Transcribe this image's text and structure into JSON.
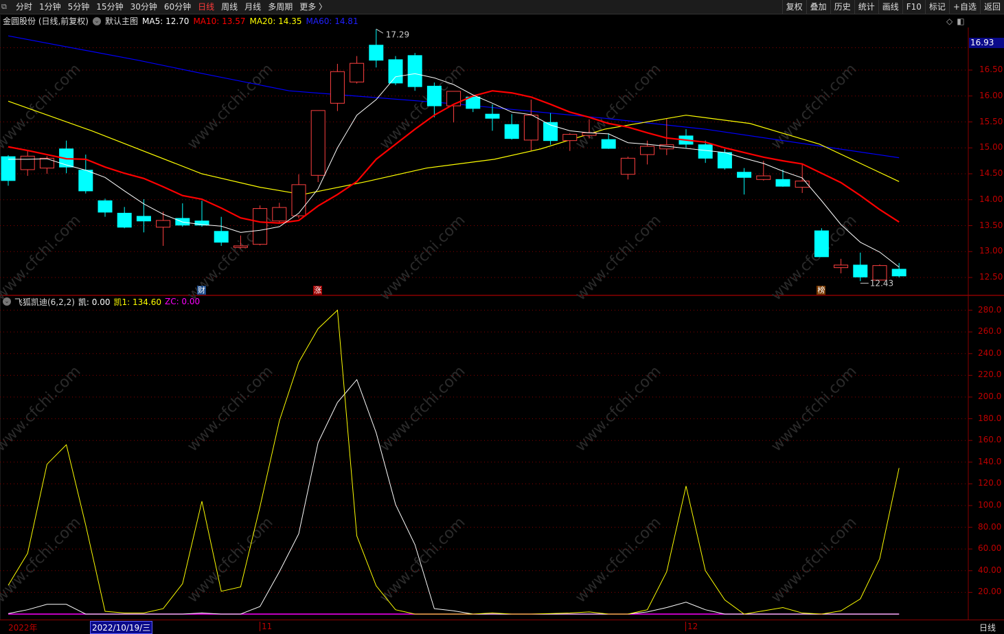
{
  "toolbar": {
    "tabs": [
      "分时",
      "1分钟",
      "5分钟",
      "15分钟",
      "30分钟",
      "60分钟",
      "日线",
      "周线",
      "月线",
      "多周期",
      "更多 〉"
    ],
    "active_tab": "日线",
    "right_buttons": [
      "复权",
      "叠加",
      "历史",
      "统计",
      "画线",
      "F10",
      "标记",
      "+自选",
      "返回"
    ]
  },
  "info": {
    "stock": "金圆股份 (日线,前复权)",
    "template": "默认主图",
    "ma5": "MA5: 12.70",
    "ma10": "MA10: 13.57",
    "ma20": "MA20: 14.35",
    "ma60": "MA60: 14.81"
  },
  "indicator_info": {
    "name": "飞狐凯迪(6,2,2)",
    "kai": "凯: 0.00",
    "kai1": "凯1: 134.60",
    "zc": "ZC: 0.00"
  },
  "colors": {
    "up": "#ff4040",
    "down": "#00ffff",
    "ma5": "#ffffff",
    "ma10": "#ff0000",
    "ma20": "#ffff00",
    "ma60": "#0000ff",
    "kai": "#ffffff",
    "kai1": "#ffff00",
    "zc": "#ff00ff",
    "grid": "#8b0000"
  },
  "price_axis": {
    "current": "16.93",
    "ticks": [
      "16.50",
      "16.00",
      "15.50",
      "15.00",
      "14.50",
      "14.00",
      "13.50",
      "13.00",
      "12.50"
    ]
  },
  "indicator_axis": {
    "ticks": [
      "280.0",
      "260.0",
      "240.0",
      "220.0",
      "200.0",
      "180.0",
      "160.0",
      "140.0",
      "120.0",
      "100.0",
      "80.00",
      "60.00",
      "40.00",
      "20.00"
    ]
  },
  "annotations": {
    "high": "17.29",
    "low": "12.43"
  },
  "markers": [
    {
      "text": "财",
      "candle": 10,
      "bg": "#1a4a8a"
    },
    {
      "text": "涨",
      "candle": 16,
      "bg": "#a00000"
    },
    {
      "text": "榜",
      "candle": 42,
      "bg": "#7a3a00"
    }
  ],
  "time_axis": {
    "year": "2022年",
    "selected_date": "2022/10/19/三",
    "month11": "11",
    "month12": "12",
    "period": "日线"
  },
  "watermark": "www.cfchi.com",
  "chart_data": [
    {
      "type": "candlestick",
      "title": "金圆股份 日线",
      "ylim": [
        12.3,
        17.35
      ],
      "ohlc": [
        [
          14.83,
          14.86,
          14.27,
          14.37
        ],
        [
          14.58,
          14.96,
          14.46,
          14.84
        ],
        [
          14.61,
          14.84,
          14.5,
          14.8
        ],
        [
          14.98,
          15.14,
          14.51,
          14.63
        ],
        [
          14.57,
          14.87,
          14.12,
          14.17
        ],
        [
          13.98,
          14.02,
          13.67,
          13.76
        ],
        [
          13.74,
          13.86,
          13.45,
          13.47
        ],
        [
          13.68,
          14.01,
          13.37,
          13.59
        ],
        [
          13.47,
          13.77,
          13.11,
          13.6
        ],
        [
          13.64,
          13.93,
          13.48,
          13.51
        ],
        [
          13.59,
          13.98,
          13.48,
          13.51
        ],
        [
          13.39,
          13.67,
          13.11,
          13.18
        ],
        [
          13.08,
          13.31,
          13.06,
          13.11
        ],
        [
          13.14,
          13.89,
          13.12,
          13.83
        ],
        [
          13.59,
          13.94,
          13.55,
          13.85
        ],
        [
          13.69,
          14.49,
          13.64,
          14.29
        ],
        [
          14.47,
          15.72,
          14.34,
          15.72
        ],
        [
          15.86,
          16.62,
          15.71,
          16.47
        ],
        [
          16.27,
          16.77,
          16.24,
          16.63
        ],
        [
          16.98,
          17.29,
          16.55,
          16.69
        ],
        [
          16.7,
          16.77,
          16.21,
          16.25
        ],
        [
          16.78,
          16.83,
          16.1,
          16.18
        ],
        [
          16.19,
          16.26,
          15.59,
          15.81
        ],
        [
          15.81,
          16.09,
          15.49,
          16.09
        ],
        [
          15.98,
          16.01,
          15.69,
          15.76
        ],
        [
          15.65,
          15.84,
          15.33,
          15.57
        ],
        [
          15.45,
          15.65,
          15.16,
          15.18
        ],
        [
          15.15,
          15.93,
          14.95,
          15.63
        ],
        [
          15.49,
          15.67,
          15.06,
          15.14
        ],
        [
          15.14,
          15.28,
          14.94,
          15.26
        ],
        [
          15.24,
          15.55,
          15.18,
          15.29
        ],
        [
          15.16,
          15.28,
          14.98,
          14.99
        ],
        [
          14.49,
          14.83,
          14.39,
          14.8
        ],
        [
          14.87,
          15.14,
          14.68,
          15.03
        ],
        [
          14.98,
          15.56,
          14.86,
          15.06
        ],
        [
          15.23,
          15.36,
          15.0,
          15.07
        ],
        [
          15.06,
          15.14,
          14.71,
          14.8
        ],
        [
          14.91,
          14.98,
          14.58,
          14.61
        ],
        [
          14.53,
          14.61,
          14.1,
          14.43
        ],
        [
          14.39,
          14.75,
          14.37,
          14.46
        ],
        [
          14.39,
          14.58,
          14.25,
          14.26
        ],
        [
          14.24,
          14.69,
          14.13,
          14.36
        ],
        [
          13.4,
          13.45,
          12.9,
          12.9
        ],
        [
          12.69,
          12.86,
          12.58,
          12.74
        ],
        [
          12.74,
          12.98,
          12.43,
          12.51
        ],
        [
          12.45,
          12.75,
          12.45,
          12.73
        ],
        [
          12.66,
          12.78,
          12.5,
          12.53
        ]
      ],
      "ma5": [
        14.78,
        14.78,
        14.79,
        14.67,
        14.57,
        14.43,
        14.17,
        13.92,
        13.72,
        13.57,
        13.52,
        13.49,
        13.37,
        13.41,
        13.48,
        13.74,
        14.21,
        15.0,
        15.63,
        15.93,
        16.37,
        16.43,
        16.35,
        16.22,
        16.02,
        15.86,
        15.69,
        15.64,
        15.44,
        15.33,
        15.29,
        15.27,
        15.1,
        15.07,
        15.03,
        14.99,
        14.95,
        14.91,
        14.8,
        14.7,
        14.55,
        14.42,
        13.98,
        13.52,
        13.18,
        12.99,
        12.7
      ],
      "ma10": [
        15.02,
        14.95,
        14.87,
        14.79,
        14.78,
        14.63,
        14.51,
        14.41,
        14.25,
        14.08,
        14.01,
        13.84,
        13.65,
        13.57,
        13.55,
        13.6,
        13.88,
        14.1,
        14.35,
        14.78,
        15.07,
        15.36,
        15.63,
        15.84,
        16.0,
        16.1,
        16.06,
        15.98,
        15.84,
        15.69,
        15.59,
        15.47,
        15.4,
        15.29,
        15.19,
        15.15,
        15.11,
        15.0,
        14.91,
        14.82,
        14.75,
        14.69,
        14.51,
        14.33,
        14.08,
        13.81,
        13.57
      ],
      "ma20_waypoints": [
        [
          0,
          15.9
        ],
        [
          4.3,
          15.33
        ],
        [
          10,
          14.5
        ],
        [
          13,
          14.24
        ],
        [
          15.2,
          14.1
        ],
        [
          18.5,
          14.35
        ],
        [
          21.6,
          14.61
        ],
        [
          25.1,
          14.78
        ],
        [
          27.5,
          14.98
        ],
        [
          30.8,
          15.36
        ],
        [
          35,
          15.63
        ],
        [
          38.3,
          15.47
        ],
        [
          41.9,
          15.07
        ],
        [
          46,
          14.35
        ]
      ],
      "ma60_waypoints": [
        [
          0,
          17.16
        ],
        [
          6.7,
          16.69
        ],
        [
          10.2,
          16.42
        ],
        [
          14.5,
          16.1
        ],
        [
          22.7,
          15.86
        ],
        [
          30.8,
          15.57
        ],
        [
          36,
          15.36
        ],
        [
          46,
          14.81
        ]
      ]
    },
    {
      "type": "line",
      "title": "飞狐凯迪(6,2,2)",
      "ylim": [
        0,
        285
      ],
      "series": [
        {
          "name": "凯",
          "values": [
            0.5,
            4,
            9,
            9,
            0,
            0,
            0,
            0,
            0,
            0,
            1,
            0,
            0,
            7,
            39,
            74,
            158,
            195,
            216,
            167,
            101,
            64,
            5,
            3,
            0,
            0,
            0,
            0,
            0,
            0,
            0,
            0,
            0,
            2,
            6,
            11,
            4,
            0,
            0,
            0,
            0,
            0,
            0,
            0,
            0,
            0,
            0
          ]
        },
        {
          "name": "凯1",
          "values": [
            26.6,
            56,
            138,
            156,
            82,
            2.5,
            1,
            1,
            5,
            28,
            104,
            21,
            25,
            99,
            178,
            232,
            263,
            280,
            72,
            26,
            4,
            0,
            0,
            0,
            0,
            1,
            0,
            0,
            0.5,
            1,
            2,
            0,
            0,
            4,
            39,
            118,
            40,
            13,
            0,
            3,
            6,
            1,
            0,
            3,
            14,
            51,
            134.6
          ]
        },
        {
          "name": "ZC",
          "values": [
            0,
            0,
            0,
            0,
            0,
            0,
            0,
            0,
            0,
            0,
            0,
            0,
            0,
            0,
            0,
            0,
            0,
            0,
            0,
            0,
            0,
            0,
            0,
            0,
            0,
            0,
            0,
            0,
            0,
            0,
            0,
            0,
            0,
            0,
            0,
            0,
            0,
            0,
            0,
            0,
            0,
            0,
            0,
            0,
            0,
            0,
            0
          ]
        }
      ]
    }
  ]
}
